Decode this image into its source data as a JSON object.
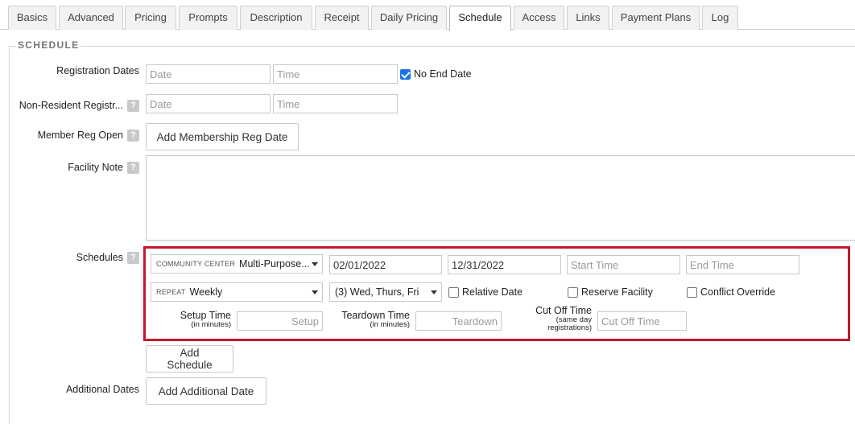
{
  "tabs": [
    {
      "label": "Basics"
    },
    {
      "label": "Advanced"
    },
    {
      "label": "Pricing"
    },
    {
      "label": "Prompts"
    },
    {
      "label": "Description"
    },
    {
      "label": "Receipt"
    },
    {
      "label": "Daily Pricing"
    },
    {
      "label": "Schedule",
      "active": true
    },
    {
      "label": "Access"
    },
    {
      "label": "Links"
    },
    {
      "label": "Payment Plans"
    },
    {
      "label": "Log"
    }
  ],
  "section": {
    "legend": "SCHEDULE"
  },
  "registration_dates": {
    "label": "Registration Dates",
    "date_placeholder": "Date",
    "time_placeholder": "Time",
    "no_end_date_label": "No End Date",
    "no_end_date_checked": true
  },
  "non_resident": {
    "label": "Non-Resident Registr...",
    "date_placeholder": "Date",
    "time_placeholder": "Time"
  },
  "member_reg": {
    "label": "Member Reg Open",
    "button": "Add Membership Reg Date"
  },
  "facility_note": {
    "label": "Facility Note",
    "value": ""
  },
  "help_glyph": "?",
  "schedules": {
    "label": "Schedules",
    "facility_prefix": "COMMUNITY CENTER",
    "facility_value": "Multi-Purpose...",
    "start_date": "02/01/2022",
    "end_date": "12/31/2022",
    "start_time_placeholder": "Start Time",
    "end_time_placeholder": "End Time",
    "repeat_prefix": "REPEAT",
    "repeat_value": "Weekly",
    "days_value": "(3) Wed, Thurs, Fri",
    "relative_date_label": "Relative Date",
    "reserve_facility_label": "Reserve Facility",
    "conflict_override_label": "Conflict Override",
    "setup_label": "Setup Time",
    "setup_sub": "(in minutes)",
    "setup_placeholder": "Setup",
    "teardown_label": "Teardown Time",
    "teardown_sub": "(in minutes)",
    "teardown_placeholder": "Teardown",
    "cutoff_label": "Cut Off Time",
    "cutoff_sub1": "(same day",
    "cutoff_sub2": "registrations)",
    "cutoff_placeholder": "Cut Off Time",
    "add_button": "Add Schedule",
    "highlight_color": "#c3172d"
  },
  "additional_dates": {
    "label": "Additional Dates",
    "button": "Add Additional Date"
  }
}
